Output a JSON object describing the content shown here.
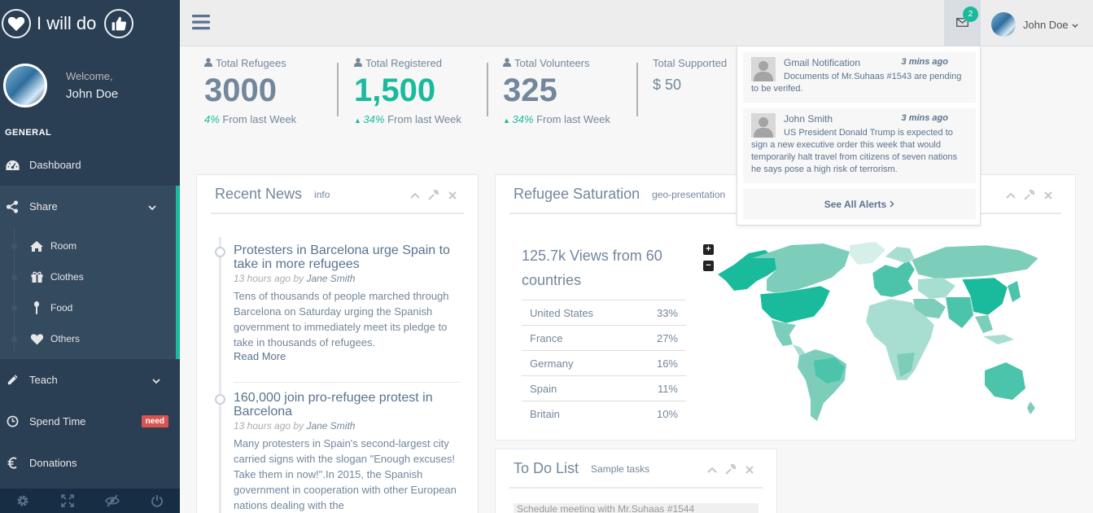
{
  "brand": {
    "name": "I will do"
  },
  "profile": {
    "welcome": "Welcome,",
    "name": "John Doe"
  },
  "sidebar": {
    "section": "GENERAL",
    "dashboard": "Dashboard",
    "share": "Share",
    "sub_items": [
      "Room",
      "Clothes",
      "Food",
      "Others"
    ],
    "teach": "Teach",
    "spend_time": "Spend Time",
    "need_badge": "need",
    "donations": "Donations"
  },
  "topnav": {
    "mail_count": "2",
    "user_name": "John Doe"
  },
  "tiles": [
    {
      "label": "Total Refugees",
      "count": "3000",
      "pct": "4%",
      "suffix": " From last Week"
    },
    {
      "label": "Total Registered",
      "count": "1,500",
      "pct": "34%",
      "suffix": " From last Week"
    },
    {
      "label": "Total Volunteers",
      "count": "325",
      "pct": "34%",
      "suffix": " From last Week"
    },
    {
      "label": "Total Supported",
      "count": "$ 50"
    }
  ],
  "news": {
    "title": "Recent News",
    "subtitle": "info",
    "items": [
      {
        "title": "Protesters in Barcelona urge Spain to take in more refugees",
        "time": "13 hours ago",
        "by": "by",
        "author": "Jane Smith",
        "text": "Tens of thousands of people marched through Barcelona on Saturday urging the Spanish government to immediately meet its pledge to take in thousands of refugees.",
        "more": "Read More"
      },
      {
        "title": "160,000 join pro-refugee protest in Barcelona",
        "time": "13 hours ago",
        "by": "by",
        "author": "Jane Smith",
        "text": "Many protesters in Spain's second-largest city carried signs with the slogan \"Enough excuses! Take them in now!\".In 2015, the Spanish government in cooperation with other European nations dealing with the"
      }
    ]
  },
  "saturation": {
    "title": "Refugee Saturation",
    "subtitle": "geo-presentation",
    "views": "125.7k Views from 60 countries",
    "countries": [
      {
        "name": "United States",
        "pct": "33%"
      },
      {
        "name": "France",
        "pct": "27%"
      },
      {
        "name": "Germany",
        "pct": "16%"
      },
      {
        "name": "Spain",
        "pct": "11%"
      },
      {
        "name": "Britain",
        "pct": "10%"
      }
    ],
    "zoom_in": "+",
    "zoom_out": "−"
  },
  "todo": {
    "title": "To Do List",
    "subtitle": "Sample tasks",
    "first_task": "Schedule meeting with Mr.Suhaas #1544"
  },
  "alerts": {
    "items": [
      {
        "from": "Gmail Notification",
        "time": "3 mins ago",
        "message": "Documents of Mr.Suhaas #1543 are pending to be verifed."
      },
      {
        "from": "John Smith",
        "time": "3 mins ago",
        "message": "US President Donald Trump is expected to sign a new executive order this week that would temporarily halt travel from citizens of seven nations he says pose a high risk of terrorism."
      }
    ],
    "see_all": "See All Alerts"
  },
  "colors": {
    "sidebar": "#2A3F54",
    "accent": "#1ABB9C",
    "danger": "#D9534F",
    "text": "#73879C"
  }
}
